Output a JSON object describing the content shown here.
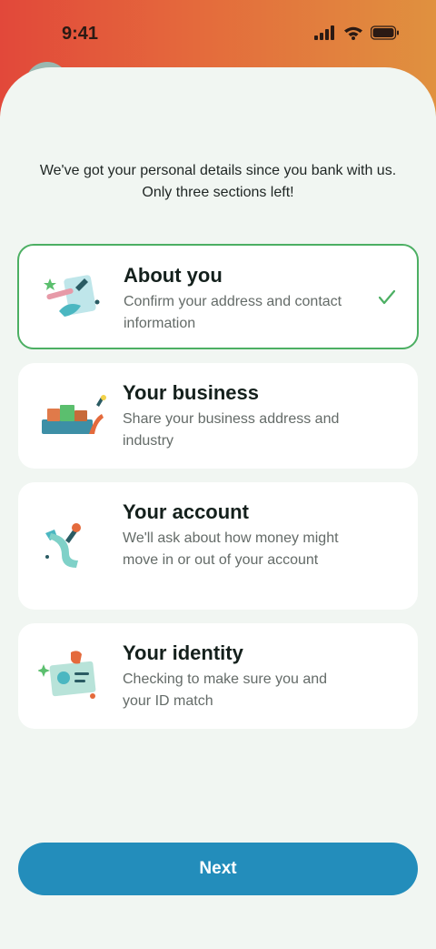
{
  "status_bar": {
    "time": "9:41",
    "icons": [
      "signal-icon",
      "wifi-icon",
      "battery-icon"
    ]
  },
  "intro_text": "We've got your personal details since you bank with us. Only three sections left!",
  "sections": [
    {
      "title": "About you",
      "description": "Confirm your address and contact information",
      "completed": true,
      "icon": "pen-document-illustration"
    },
    {
      "title": "Your business",
      "description": "Share your business address and industry",
      "completed": false,
      "icon": "business-illustration"
    },
    {
      "title": "Your account",
      "description": "We'll ask about how money might move in or out of your account",
      "completed": false,
      "icon": "account-flow-illustration"
    },
    {
      "title": "Your identity",
      "description": "Checking to make sure you and your ID match",
      "completed": false,
      "icon": "id-card-illustration"
    }
  ],
  "next_label": "Next",
  "colors": {
    "accent": "#238dbb",
    "success": "#4caf63",
    "background": "#f1f6f2"
  }
}
